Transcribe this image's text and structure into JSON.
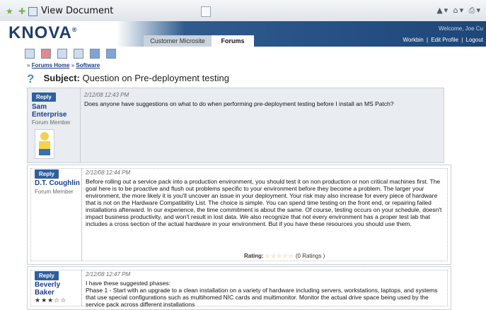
{
  "browser": {
    "title": "View Document",
    "tools": "▲▾  ⌂▾  ⎙▾"
  },
  "app": {
    "logo": "KNOVA",
    "logo_mark": "®",
    "tabs": [
      {
        "label": "Customer Microsite"
      },
      {
        "label": "Forums"
      }
    ],
    "welcome": "Welcome, Joe Cu",
    "links": [
      "Workbin",
      "|",
      "Edit Profile",
      "|",
      "Logout"
    ]
  },
  "breadcrumb": {
    "prefix": "»",
    "forums_home": "Forums Home",
    "sep": "»",
    "software": "Software"
  },
  "subject": {
    "label": "Subject:",
    "text": "Question on Pre-deployment testing"
  },
  "posts": [
    {
      "reply": "Reply",
      "author_line1": "Sam",
      "author_line2": "Enterprise",
      "role": "Forum Member",
      "timestamp": "2/12/08 12:43 PM",
      "body": "Does anyone have suggestions on what to do when performing pre-deployment testing before I install an MS Patch?"
    },
    {
      "reply": "Reply",
      "author_line1": "D.T. Coughlin",
      "role": "Forum Member",
      "timestamp": "2/12/08 12:44 PM",
      "body": "Before rolling out a service pack into a production environment, you should test it on non production or non critical machines first. The goal here is to be proactive and flush out problems specific to your environment before they become a problem. The larger your environment, the more likely it is you'll uncover an issue in your deployment. Your risk may also increase for every piece of hardware that is not on the Hardware Compatibility List. The choice is simple. You can spend time testing on the front end, or repairing failed installations afterward. In our experience, the time commitment is about the same. Of course, testing occurs on your schedule, doesn't impact business productivity, and won't result in lost data. We also recognize that not every environment has a proper test lab that includes a cross section of the actual hardware in your environment. But if you have these resources you should use them.",
      "rating_label": "Rating:",
      "rating_stars": "☆☆☆☆☆",
      "rating_count": "(0 Ratings )"
    },
    {
      "reply": "Reply",
      "author_line1": "Beverly",
      "author_line2": "Baker",
      "author_stars": "★★★☆☆",
      "timestamp": "2/12/08 12:47 PM",
      "body": "I have these suggested phases:\nPhase 1 - Start with an upgrade to a clean installation on a variety of hardware including servers, workstations, laptops, and systems that use special configurations such as multihomed NIC cards and multimonitor. Monitor the actual drive space being used by the service pack across different installations"
    }
  ],
  "colors": {
    "accent": "#2f5f9f",
    "header_dark": "#1f4678",
    "link": "#1b3f8b"
  }
}
